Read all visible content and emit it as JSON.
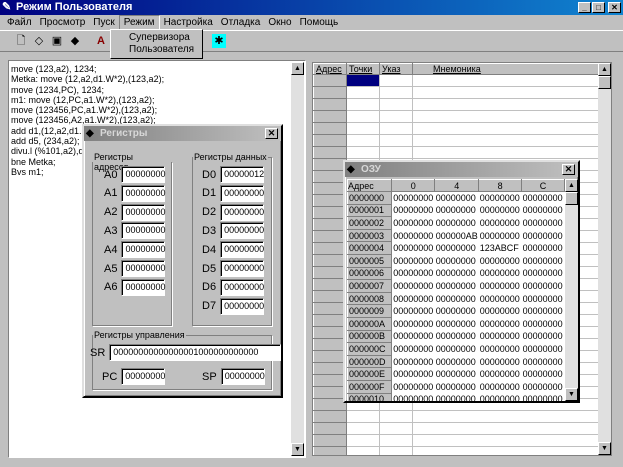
{
  "window": {
    "title": "Режим Пользователя"
  },
  "menu": [
    "Файл",
    "Просмотр",
    "Пуск",
    "Режим",
    "Настройка",
    "Отладка",
    "Окно",
    "Помощь"
  ],
  "mode_menu": [
    "Супервизора",
    "Пользователя"
  ],
  "toolbar_icons": [
    "new-file-icon",
    "open-icon",
    "save-icon",
    "erase-icon",
    "font-icon",
    "run-icon"
  ],
  "editor_lines": [
    "move (123,a2), 1234;",
    "Metka: move (12,a2,d1.W*2),(123,a2);",
    "move (1234,PC), 1234;",
    "m1: move (12,PC,a1.W*2),(123,a2);",
    "move (123456,PC,a1.W*2),(123,a2);",
    "move (123456,A2,a1.W*2),(123,a2);",
    "add d1,(12,a2,d1.L*",
    "add d5, (234,a2);",
    "divu.l (%101,a2),d1:",
    "bne Metka;",
    "Bvs m1;"
  ],
  "program_grid": {
    "columns": [
      "Адрес",
      "Точки",
      "Указ",
      "Мнемоника"
    ]
  },
  "registers": {
    "title": "Регистры",
    "address_group": "Регистры адресов",
    "data_group": "Регистры данных",
    "control_group": "Регистры управления",
    "address": [
      {
        "name": "A0",
        "value": "00000000"
      },
      {
        "name": "A1",
        "value": "00000000"
      },
      {
        "name": "A2",
        "value": "00000000"
      },
      {
        "name": "A3",
        "value": "00000000"
      },
      {
        "name": "A4",
        "value": "00000000"
      },
      {
        "name": "A5",
        "value": "00000000"
      },
      {
        "name": "A6",
        "value": "00000000"
      }
    ],
    "data": [
      {
        "name": "D0",
        "value": "00000012"
      },
      {
        "name": "D1",
        "value": "00000000"
      },
      {
        "name": "D2",
        "value": "00000000"
      },
      {
        "name": "D3",
        "value": "00000000"
      },
      {
        "name": "D4",
        "value": "00000000"
      },
      {
        "name": "D5",
        "value": "00000000"
      },
      {
        "name": "D6",
        "value": "00000000"
      },
      {
        "name": "D7",
        "value": "00000000"
      }
    ],
    "sr": {
      "name": "SR",
      "value": "00000000000000001000000000000"
    },
    "pc": {
      "name": "PC",
      "value": "00000000"
    },
    "sp": {
      "name": "SP",
      "value": "00000000"
    }
  },
  "ram": {
    "title": "ОЗУ",
    "columns": [
      "Адрес",
      "0",
      "4",
      "8",
      "C"
    ],
    "rows": [
      [
        "0000000",
        "00000000",
        "00000000",
        "00000000",
        "00000000"
      ],
      [
        "0000001",
        "00000000",
        "00000000",
        "00000000",
        "00000000"
      ],
      [
        "0000002",
        "00000000",
        "00000000",
        "00000000",
        "00000000"
      ],
      [
        "0000003",
        "00000000",
        "000000AB",
        "00000000",
        "00000000"
      ],
      [
        "0000004",
        "00000000",
        "00000000",
        "123ABCF",
        "00000000"
      ],
      [
        "0000005",
        "00000000",
        "00000000",
        "00000000",
        "00000000"
      ],
      [
        "0000006",
        "00000000",
        "00000000",
        "00000000",
        "00000000"
      ],
      [
        "0000007",
        "00000000",
        "00000000",
        "00000000",
        "00000000"
      ],
      [
        "0000008",
        "00000000",
        "00000000",
        "00000000",
        "00000000"
      ],
      [
        "0000009",
        "00000000",
        "00000000",
        "00000000",
        "00000000"
      ],
      [
        "000000A",
        "00000000",
        "00000000",
        "00000000",
        "00000000"
      ],
      [
        "000000B",
        "00000000",
        "00000000",
        "00000000",
        "00000000"
      ],
      [
        "000000C",
        "00000000",
        "00000000",
        "00000000",
        "00000000"
      ],
      [
        "000000D",
        "00000000",
        "00000000",
        "00000000",
        "00000000"
      ],
      [
        "000000E",
        "00000000",
        "00000000",
        "00000000",
        "00000000"
      ],
      [
        "000000F",
        "00000000",
        "00000000",
        "00000000",
        "00000000"
      ],
      [
        "0000010",
        "00000000",
        "00000000",
        "00000000",
        "00000000"
      ]
    ]
  },
  "colors": {
    "title_active": "#000080",
    "selection": "#000080",
    "face": "#c0c0c0"
  }
}
